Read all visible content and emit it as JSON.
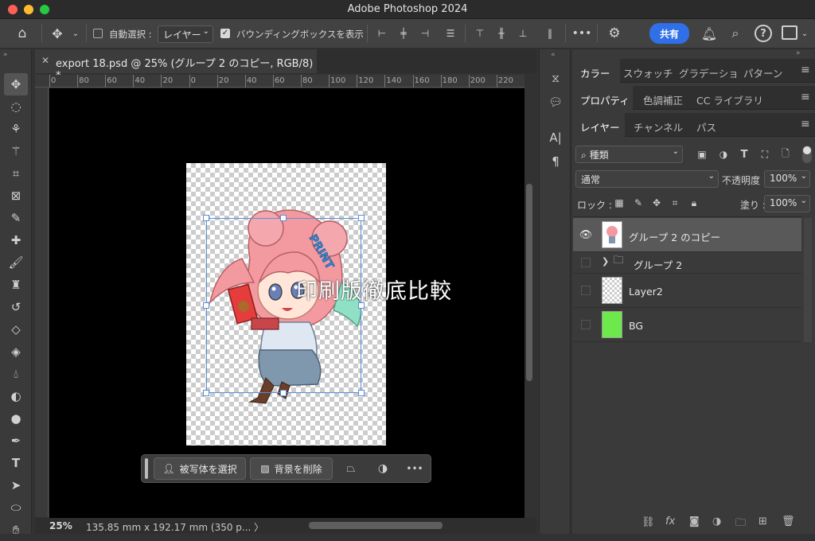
{
  "window": {
    "title": "Adobe Photoshop 2024"
  },
  "options_bar": {
    "auto_select_label": "自動選択 :",
    "auto_select_value": "レイヤー",
    "bounding_box_label": "バウンディングボックスを表示",
    "share_label": "共有"
  },
  "document": {
    "tab_title": "export 18.psd @ 25% (グループ 2 のコピー, RGB/8) *",
    "ruler_ticks": [
      "0",
      "80",
      "60",
      "40",
      "20",
      "0",
      "20",
      "40",
      "60",
      "80",
      "100",
      "120",
      "140",
      "160",
      "180",
      "200",
      "220"
    ],
    "watermark_text": "印刷版徹底比較",
    "zoom": "25%",
    "doc_size": "135.85 mm x 192.17 mm (350 p... 〉"
  },
  "context_bar": {
    "select_subject_label": "被写体を選択",
    "remove_bg_label": "背景を削除"
  },
  "panels": {
    "group1_tabs": [
      "カラー",
      "スウォッチ",
      "グラデーショ",
      "パターン"
    ],
    "group2_tabs": [
      "プロパティ",
      "色調補正",
      "CC ライブラリ"
    ],
    "group3_tabs": [
      "レイヤー",
      "チャンネル",
      "パス"
    ]
  },
  "layers": {
    "filter_value": "種類",
    "blend_mode": "通常",
    "opacity_label": "不透明度 :",
    "opacity_value": "100%",
    "lock_label": "ロック :",
    "fill_label": "塗り :",
    "fill_value": "100%",
    "items": [
      {
        "name": "グループ 2 のコピー",
        "visible": true,
        "selected": true
      },
      {
        "name": "グループ 2",
        "visible": false,
        "selected": false
      },
      {
        "name": "Layer2",
        "visible": false,
        "selected": false
      },
      {
        "name": "BG",
        "visible": false,
        "selected": false
      }
    ]
  },
  "colors": {
    "accent": "#2f6fe8",
    "bg_layer": "#6ee94c",
    "selection_outline": "#5a8fd8"
  }
}
